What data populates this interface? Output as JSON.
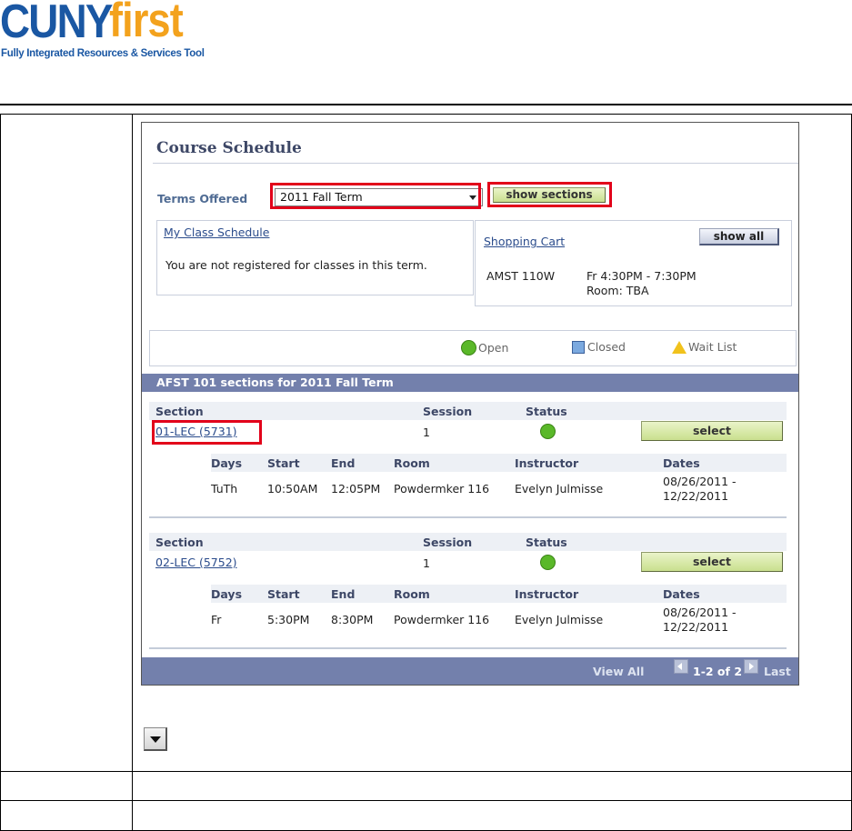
{
  "logo": {
    "cuny": "CUNY",
    "first": "first",
    "tagline": "Fully Integrated Resources & Services Tool"
  },
  "course_schedule": {
    "title": "Course Schedule",
    "terms_label": "Terms Offered",
    "term_selected": "2011 Fall Term",
    "show_sections_label": "show sections",
    "my_class_schedule": {
      "link": "My Class Schedule",
      "message": "You are not registered for classes in this term."
    },
    "shopping_cart": {
      "link": "Shopping Cart",
      "show_all_label": "show all",
      "course": "AMST 110W",
      "time": "Fr 4:30PM - 7:30PM",
      "room": "Room:  TBA"
    },
    "legend": {
      "open": "Open",
      "closed": "Closed",
      "wait_list": "Wait List"
    },
    "sections_header": "AFST 101 sections for 2011 Fall Term",
    "columns": {
      "section": "Section",
      "session": "Session",
      "status": "Status"
    },
    "sub_columns": {
      "days": "Days",
      "start": "Start",
      "end": "End",
      "room": "Room",
      "instructor": "Instructor",
      "dates": "Dates"
    },
    "sections": [
      {
        "section": "01-LEC (5731)",
        "session": "1",
        "status": "Open",
        "select_label": "select",
        "days": "TuTh",
        "start": "10:50AM",
        "end": "12:05PM",
        "room": "Powdermker 116",
        "instructor": "Evelyn Julmisse",
        "dates_start": "08/26/2011 -",
        "dates_end": "12/22/2011"
      },
      {
        "section": "02-LEC (5752)",
        "session": "1",
        "status": "Open",
        "select_label": "select",
        "days": "Fr",
        "start": "5:30PM",
        "end": "8:30PM",
        "room": "Powdermker 116",
        "instructor": "Evelyn Julmisse",
        "dates_start": "08/26/2011 -",
        "dates_end": "12/22/2011"
      }
    ],
    "footer": {
      "view_all": "View All",
      "count": "1-2 of 2",
      "last": "Last"
    }
  },
  "colors": {
    "accent": "#7380ac",
    "highlight": "#e2001a",
    "open_status": "#5ab829"
  },
  "icons": [
    "dropdown-arrow-icon",
    "open-status-icon",
    "closed-status-icon",
    "wait-list-icon",
    "previous-icon",
    "next-icon"
  ]
}
